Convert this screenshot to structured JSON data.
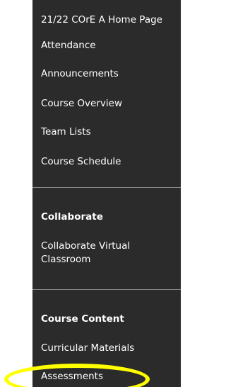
{
  "sidebar": {
    "items_top": [
      {
        "label": "21/22 COrE A Home Page"
      },
      {
        "label": "Attendance"
      },
      {
        "label": "Announcements"
      },
      {
        "label": "Course Overview"
      },
      {
        "label": "Team Lists"
      },
      {
        "label": "Course Schedule"
      }
    ],
    "collaborate": {
      "heading": "Collaborate",
      "items": [
        {
          "label": "Collaborate Virtual Classroom"
        }
      ]
    },
    "course_content": {
      "heading": "Course Content",
      "items": [
        {
          "label": "Curricular Materials"
        },
        {
          "label": "Assessments"
        }
      ]
    }
  },
  "annotation": {
    "highlight_color": "#ffff00",
    "highlighted_item": "Assessments"
  }
}
